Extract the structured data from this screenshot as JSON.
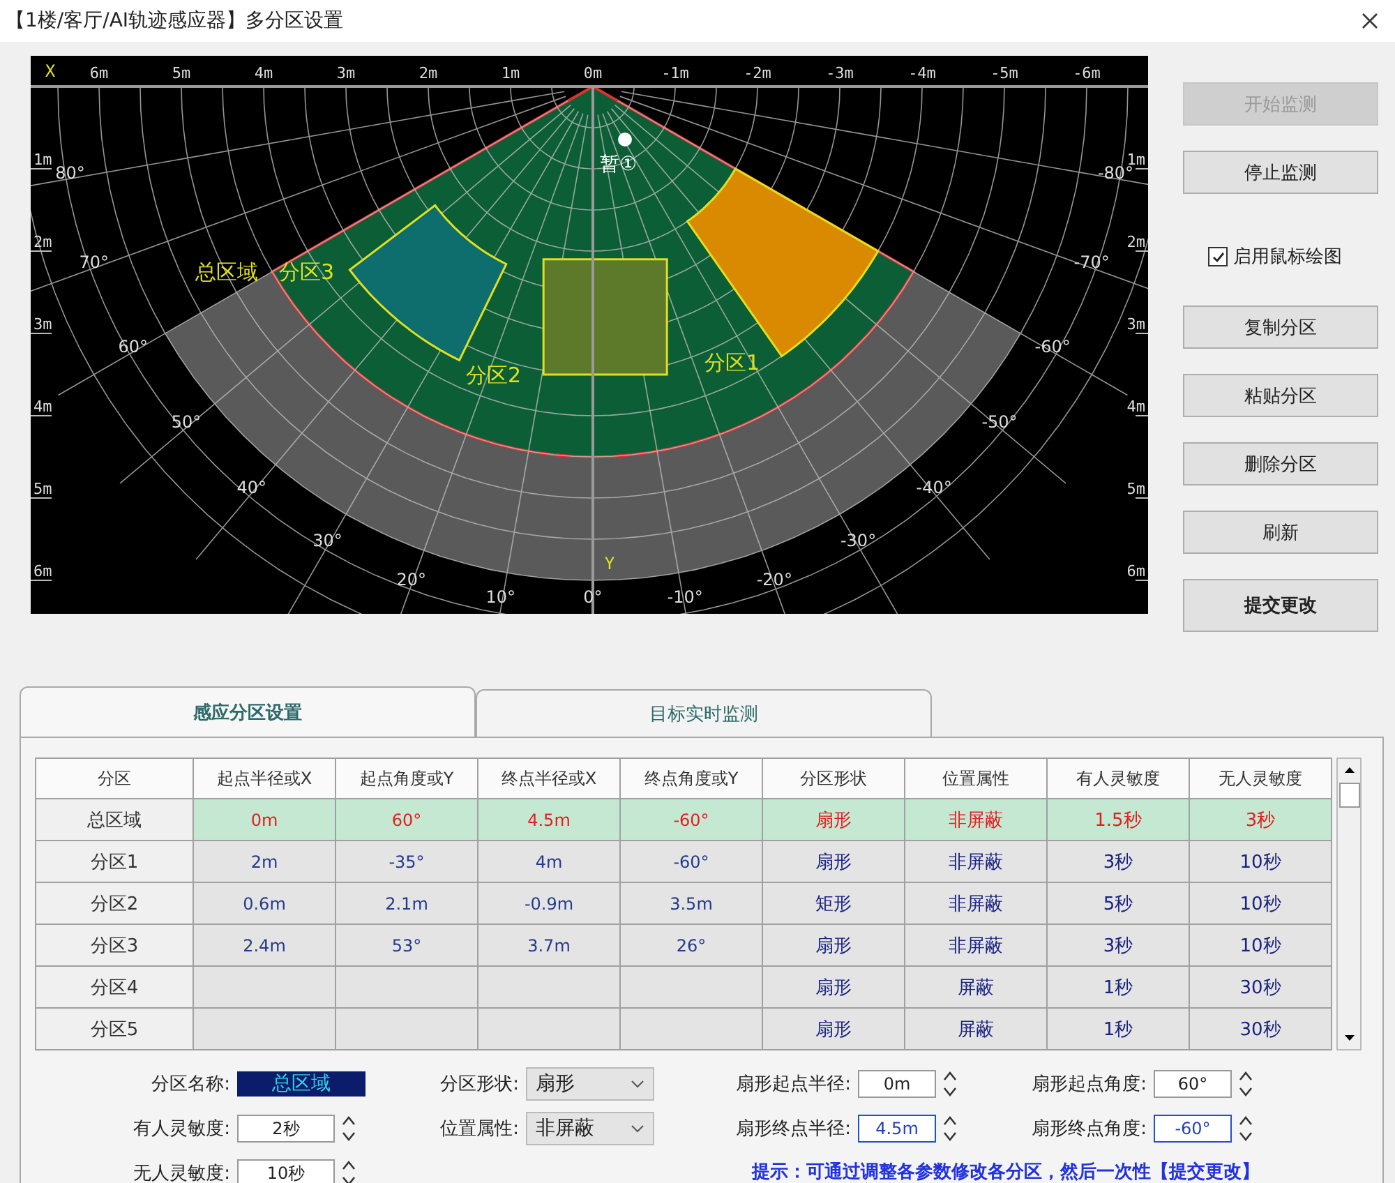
{
  "window": {
    "title": "【1楼/客厅/AI轨迹感应器】多分区设置"
  },
  "radar": {
    "x_axis_label": "X",
    "y_axis_label": "Y",
    "x_ticks": [
      "6m",
      "5m",
      "4m",
      "3m",
      "2m",
      "1m",
      "0m",
      "-1m",
      "-2m",
      "-3m",
      "-4m",
      "-5m",
      "-6m"
    ],
    "y_ticks_left": [
      "1m",
      "2m",
      "3m",
      "4m",
      "5m",
      "6m"
    ],
    "y_ticks_right": [
      "1m",
      "2m",
      "3m",
      "4m",
      "5m",
      "6m"
    ],
    "angle_labels_left": [
      "80°",
      "70°",
      "60°",
      "50°",
      "40°",
      "30°",
      "20°",
      "10°"
    ],
    "angle_labels_right": [
      "-80°",
      "-70°",
      "-60°",
      "-50°",
      "-40°",
      "-30°",
      "-20°",
      "-10°"
    ],
    "bottom_angle": "0°",
    "zones": [
      {
        "label": "总区域",
        "color": "#0b5e36"
      },
      {
        "label": "分区1",
        "color": "#d98a00"
      },
      {
        "label": "分区2",
        "color": "#5c7a2a"
      },
      {
        "label": "分区3",
        "color": "#0e6e6e"
      }
    ],
    "target": {
      "label": "暂①"
    }
  },
  "buttons": [
    {
      "label": "开始监测",
      "disabled": true
    },
    {
      "label": "停止监测",
      "disabled": false
    }
  ],
  "mouse_draw": {
    "label": "启用鼠标绘图",
    "checked": true
  },
  "actions": [
    {
      "label": "复制分区",
      "bold": false
    },
    {
      "label": "粘贴分区",
      "bold": false
    },
    {
      "label": "删除分区",
      "bold": false
    },
    {
      "label": "刷新",
      "bold": false
    },
    {
      "label": "提交更改",
      "bold": true
    }
  ],
  "tabs": [
    {
      "label": "感应分区设置",
      "selected": true
    },
    {
      "label": "目标实时监测",
      "selected": false
    }
  ],
  "table": {
    "columns": [
      "分区",
      "起点半径或X",
      "起点角度或Y",
      "终点半径或X",
      "终点角度或Y",
      "分区形状",
      "位置属性",
      "有人灵敏度",
      "无人灵敏度"
    ],
    "rows": [
      {
        "name": "总区域",
        "selected": true,
        "kind": "sector",
        "start_r": "0m",
        "start_a": "60°",
        "end_r": "4.5m",
        "end_a": "-60°",
        "shape": "扇形",
        "position": "非屏蔽",
        "occupied": "1.5秒",
        "vacant": "3秒"
      },
      {
        "name": "分区1",
        "selected": false,
        "kind": "sector",
        "start_r": "2m",
        "start_a": "-35°",
        "end_r": "4m",
        "end_a": "-60°",
        "shape": "扇形",
        "position": "非屏蔽",
        "occupied": "3秒",
        "vacant": "10秒"
      },
      {
        "name": "分区2",
        "selected": false,
        "kind": "rect",
        "start_r": "0.6m",
        "start_a": "2.1m",
        "end_r": "-0.9m",
        "end_a": "3.5m",
        "shape": "矩形",
        "position": "非屏蔽",
        "occupied": "5秒",
        "vacant": "10秒"
      },
      {
        "name": "分区3",
        "selected": false,
        "kind": "sector",
        "start_r": "2.4m",
        "start_a": "53°",
        "end_r": "3.7m",
        "end_a": "26°",
        "shape": "扇形",
        "position": "非屏蔽",
        "occupied": "3秒",
        "vacant": "10秒"
      },
      {
        "name": "分区4",
        "selected": false,
        "kind": "sector",
        "shape": "扇形",
        "position": "屏蔽",
        "occupied": "1秒",
        "vacant": "30秒"
      },
      {
        "name": "分区5",
        "selected": false,
        "kind": "sector",
        "shape": "扇形",
        "position": "屏蔽",
        "occupied": "1秒",
        "vacant": "30秒"
      }
    ]
  },
  "form": {
    "name": {
      "label": "分区名称:",
      "value": "总区域",
      "text_selected": true
    },
    "occupied": {
      "label": "有人灵敏度:",
      "value": "2秒"
    },
    "vacant": {
      "label": "无人灵敏度:",
      "value": "10秒"
    },
    "shape": {
      "label": "分区形状:",
      "value": "扇形"
    },
    "position": {
      "label": "位置属性:",
      "value": "非屏蔽"
    },
    "start_r": {
      "label": "扇形起点半径:",
      "value": "0m",
      "focused": false
    },
    "end_r": {
      "label": "扇形终点半径:",
      "value": "4.5m",
      "focused": true
    },
    "start_a": {
      "label": "扇形起点角度:",
      "value": "60°",
      "focused": false
    },
    "end_a": {
      "label": "扇形终点角度:",
      "value": "-60°",
      "focused": true
    },
    "hint": "提示：可通过调整各参数修改各分区，然后一次性【提交更改】"
  }
}
